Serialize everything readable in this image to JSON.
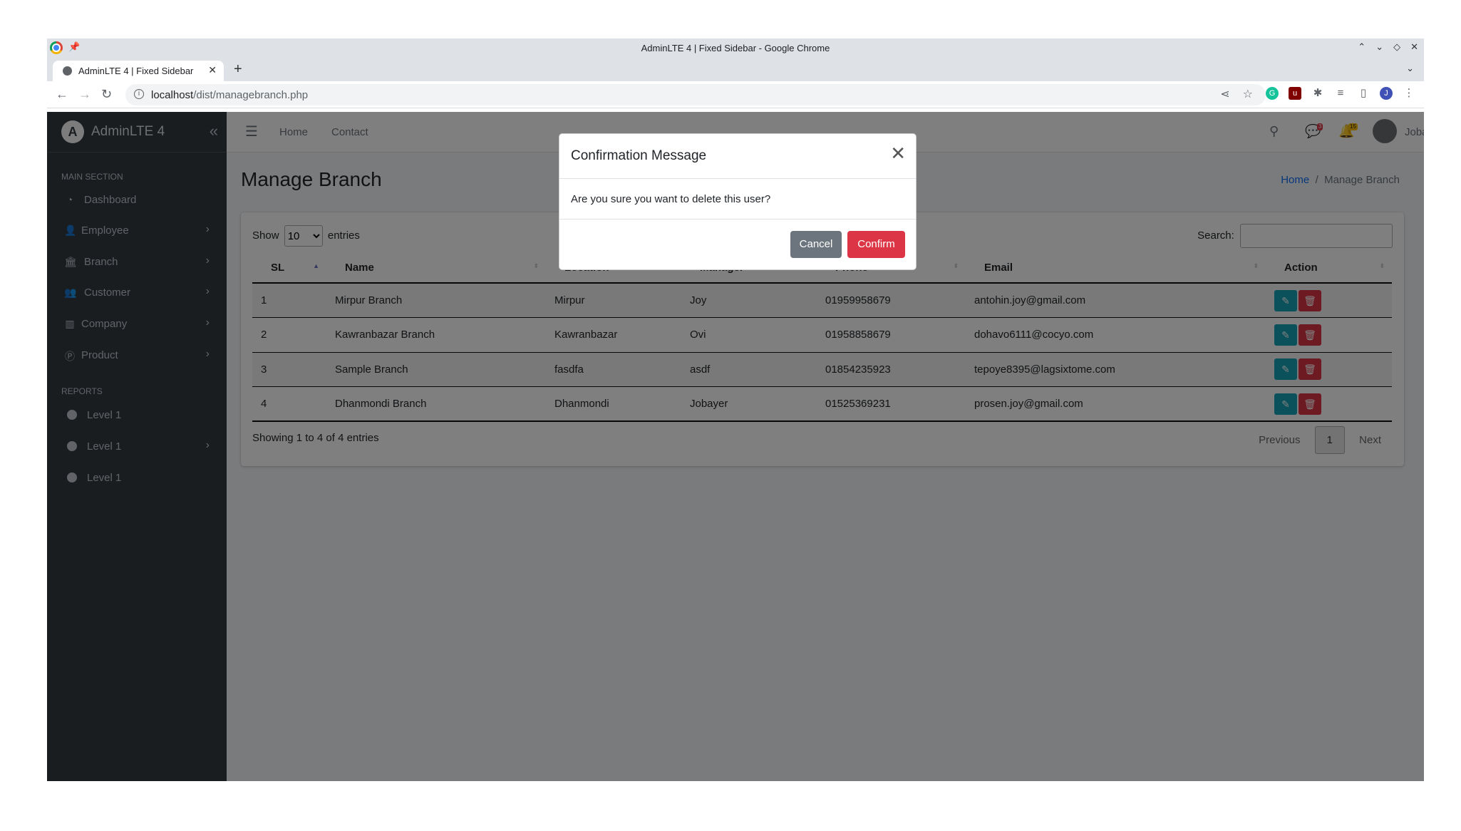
{
  "browser": {
    "window_title": "AdminLTE 4 | Fixed Sidebar - Google Chrome",
    "tab_title": "AdminLTE 4 | Fixed Sidebar",
    "url_host": "localhost",
    "url_path": "/dist/managebranch.php",
    "profile_initial": "J"
  },
  "sidebar": {
    "brand": "AdminLTE 4",
    "brand_logo": "A",
    "section_main": "MAIN SECTION",
    "section_reports": "REPORTS",
    "items": [
      {
        "label": "Dashboard",
        "icon": "dashboard-icon"
      },
      {
        "label": "Employee",
        "icon": "user-icon"
      },
      {
        "label": "Branch",
        "icon": "bank-icon"
      },
      {
        "label": "Customer",
        "icon": "users-icon"
      },
      {
        "label": "Company",
        "icon": "building-icon"
      },
      {
        "label": "Product",
        "icon": "product-icon"
      }
    ],
    "report_items": [
      {
        "label": "Level 1"
      },
      {
        "label": "Level 1"
      },
      {
        "label": "Level 1"
      }
    ]
  },
  "topnav": {
    "home": "Home",
    "contact": "Contact",
    "messages_badge": "3",
    "notifications_badge": "15",
    "user": "Jobayer"
  },
  "page": {
    "title": "Manage Branch",
    "breadcrumb_home": "Home",
    "breadcrumb_sep": "/",
    "breadcrumb_current": "Manage Branch"
  },
  "datatable": {
    "show_label": "Show",
    "entries_label": "entries",
    "page_length": "10",
    "search_label": "Search:",
    "columns": [
      "SL",
      "Name",
      "Location",
      "Manager",
      "Phone",
      "Email",
      "Action"
    ],
    "rows": [
      {
        "sl": "1",
        "name": "Mirpur Branch",
        "location": "Mirpur",
        "manager": "Joy",
        "phone": "01959958679",
        "email": "antohin.joy@gmail.com"
      },
      {
        "sl": "2",
        "name": "Kawranbazar Branch",
        "location": "Kawranbazar",
        "manager": "Ovi",
        "phone": "01958858679",
        "email": "dohavo6111@cocyo.com"
      },
      {
        "sl": "3",
        "name": "Sample Branch",
        "location": "fasdfa",
        "manager": "asdf",
        "phone": "01854235923",
        "email": "tepoye8395@lagsixtome.com"
      },
      {
        "sl": "4",
        "name": "Dhanmondi Branch",
        "location": "Dhanmondi",
        "manager": "Jobayer",
        "phone": "01525369231",
        "email": "prosen.joy@gmail.com"
      }
    ],
    "info": "Showing 1 to 4 of 4 entries",
    "prev": "Previous",
    "current_page": "1",
    "next": "Next"
  },
  "modal": {
    "title": "Confirmation Message",
    "body": "Are you sure you want to delete this user?",
    "cancel": "Cancel",
    "confirm": "Confirm"
  },
  "colors": {
    "sidebar_bg": "#343a40",
    "edit_btn": "#17a2b8",
    "delete_btn": "#dc3545",
    "cancel_btn": "#6c757d",
    "link": "#0d6efd"
  }
}
